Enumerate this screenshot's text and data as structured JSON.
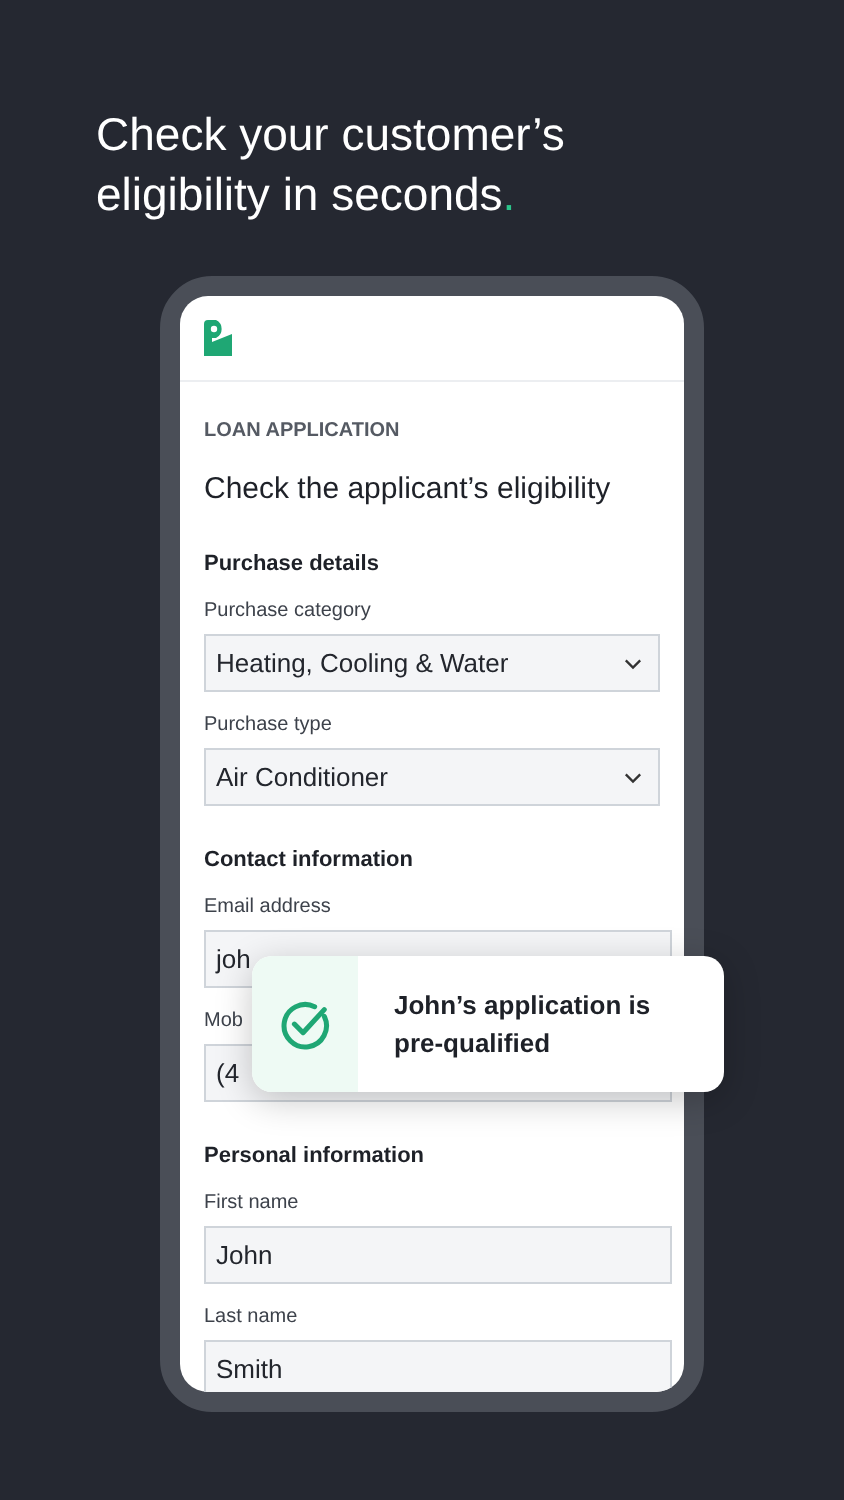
{
  "headline": {
    "text": "Check your customer’s eligibility in seconds",
    "end_mark": "."
  },
  "screen": {
    "overline": "LOAN APPLICATION",
    "title": "Check the applicant’s eligibility",
    "sections": [
      {
        "heading": "Purchase details",
        "fields": [
          {
            "label": "Purchase category",
            "kind": "select",
            "value": "Heating, Cooling & Water"
          },
          {
            "label": "Purchase type",
            "kind": "select",
            "value": "Air Conditioner"
          }
        ]
      },
      {
        "heading": "Contact information",
        "fields": [
          {
            "label": "Email address",
            "kind": "text",
            "value": "joh"
          },
          {
            "label": "Mob",
            "kind": "text",
            "value": "(4"
          }
        ]
      },
      {
        "heading": "Personal information",
        "fields": [
          {
            "label": "First name",
            "kind": "text",
            "value": "John"
          },
          {
            "label": "Last name",
            "kind": "text",
            "value": "Smith"
          }
        ]
      }
    ]
  },
  "toast": {
    "message": "John’s application is pre-qualified"
  }
}
